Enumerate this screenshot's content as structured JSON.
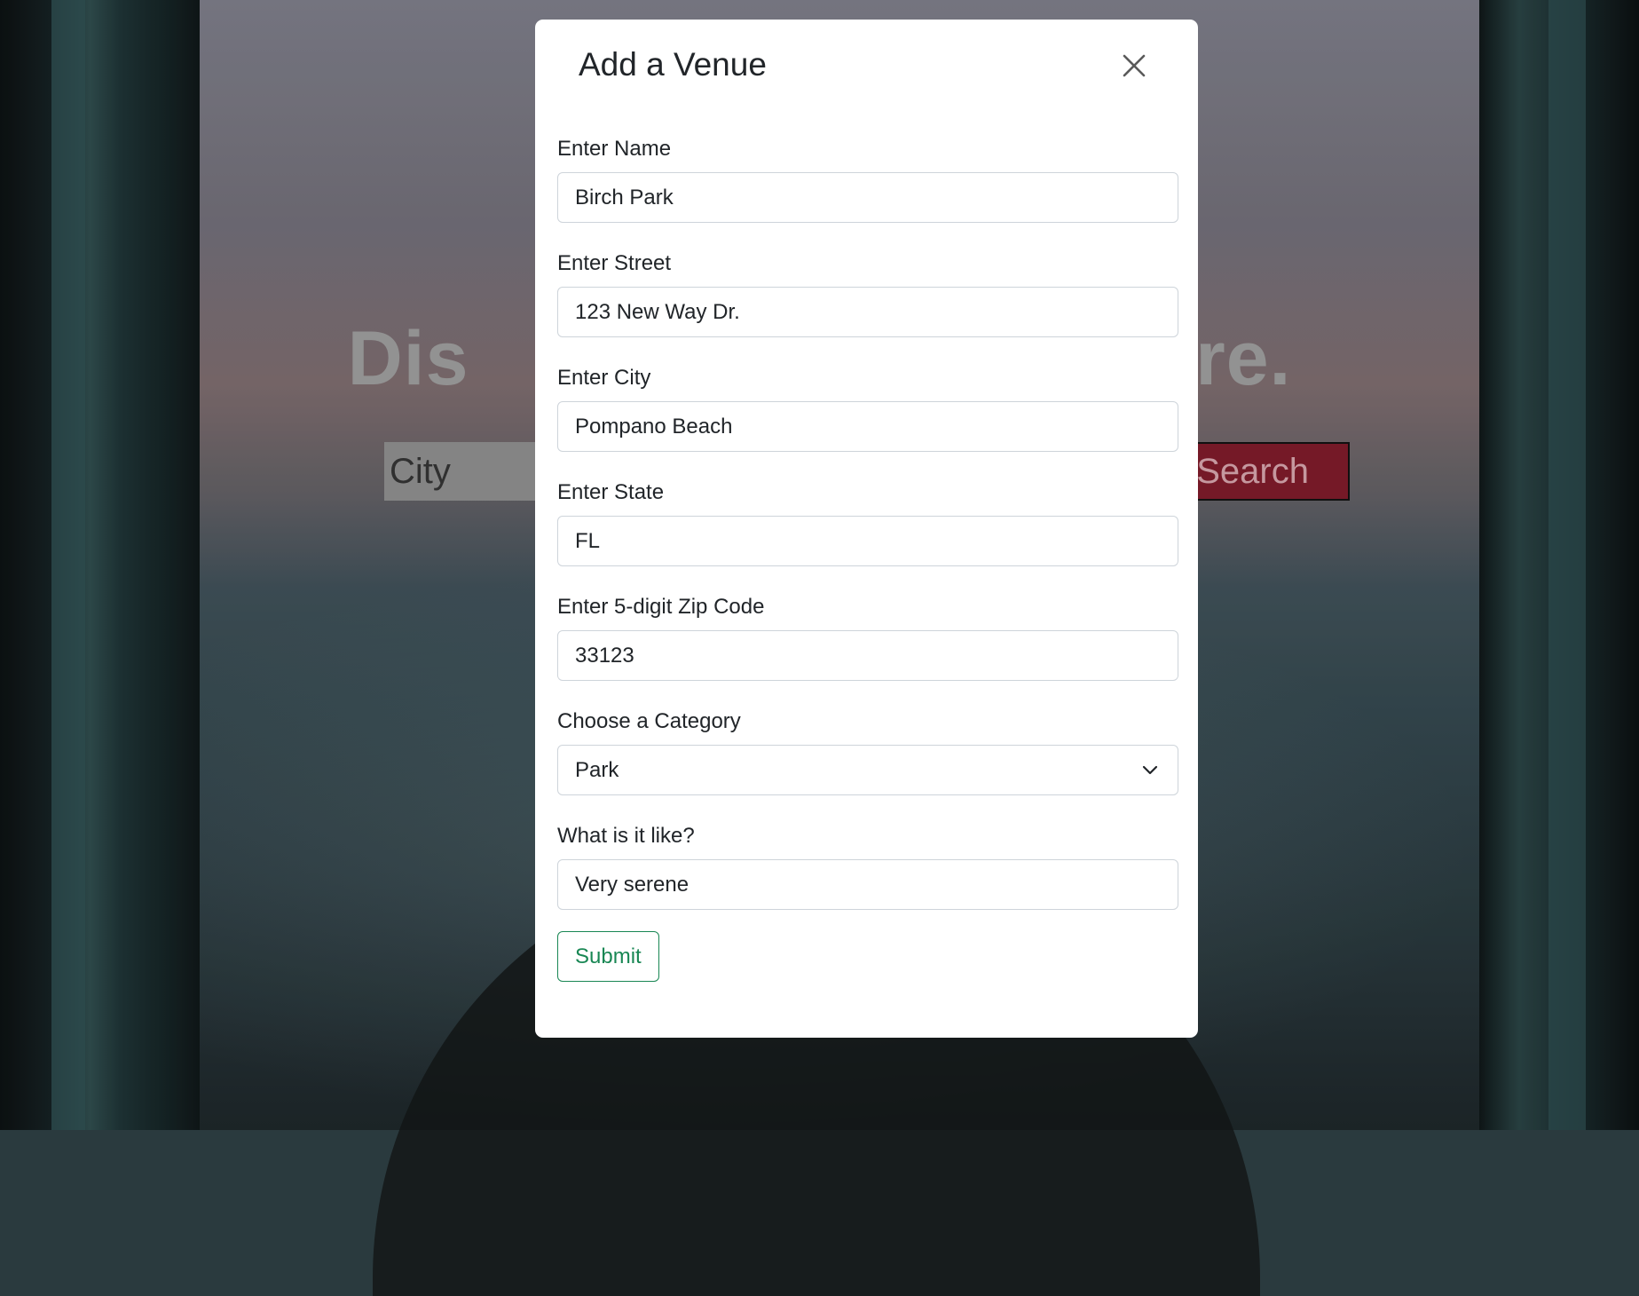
{
  "background": {
    "hero_left": "Dis",
    "hero_right": "ere.",
    "search_placeholder": "City",
    "search_button": "Search"
  },
  "modal": {
    "title": "Add a Venue",
    "close_icon": "close-icon",
    "fields": {
      "name": {
        "label": "Enter Name",
        "value": "Birch Park"
      },
      "street": {
        "label": "Enter Street",
        "value": "123 New Way Dr."
      },
      "city": {
        "label": "Enter City",
        "value": "Pompano Beach"
      },
      "state": {
        "label": "Enter State",
        "value": "FL"
      },
      "zip": {
        "label": "Enter 5-digit Zip Code",
        "value": "33123"
      },
      "category": {
        "label": "Choose a Category",
        "value": "Park",
        "icon": "chevron-down-icon"
      },
      "description": {
        "label": "What is it like?",
        "value": "Very serene"
      }
    },
    "submit_label": "Submit",
    "colors": {
      "submit": "#198754",
      "search_button": "#7c1b2a"
    }
  }
}
